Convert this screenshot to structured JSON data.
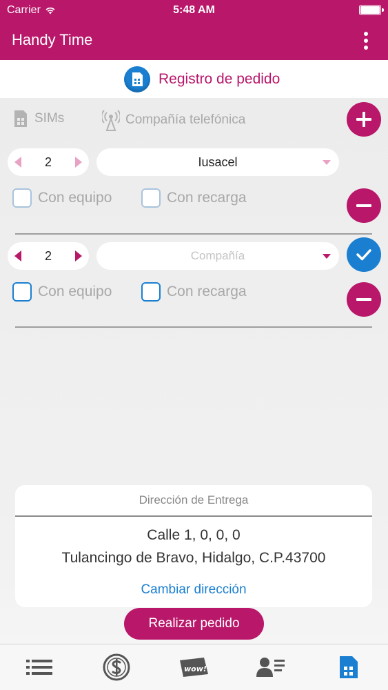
{
  "status_bar": {
    "carrier": "Carrier",
    "time": "5:48 AM"
  },
  "app_bar": {
    "title": "Handy Time"
  },
  "header": {
    "title": "Registro de pedido"
  },
  "columns": {
    "sims": "SIMs",
    "company": "Compañía telefónica"
  },
  "orders": [
    {
      "quantity": "2",
      "company_value": "Iusacel",
      "company_placeholder": "Compañía",
      "with_device": "Con equipo",
      "with_recharge": "Con recarga",
      "state": "disabled"
    },
    {
      "quantity": "2",
      "company_value": "",
      "company_placeholder": "Compañía",
      "with_device": "Con equipo",
      "with_recharge": "Con recarga",
      "state": "active"
    }
  ],
  "delivery": {
    "header": "Dirección de Entrega",
    "address_line1": "Calle 1, 0, 0, 0",
    "address_line2": "Tulancingo de Bravo, Hidalgo, C.P.43700",
    "change_link": "Cambiar dirección"
  },
  "actions": {
    "submit": "Realizar pedido"
  },
  "tabs": [
    {
      "icon": "list-icon"
    },
    {
      "icon": "dollar-coin-icon"
    },
    {
      "icon": "wow-tag-icon"
    },
    {
      "icon": "contact-card-icon"
    },
    {
      "icon": "sim-card-icon"
    }
  ],
  "colors": {
    "brand": "#b8176a",
    "accent_blue": "#1a7fd1",
    "disabled_pink": "#e8a3c4",
    "disabled_border": "#a9c3dc"
  }
}
